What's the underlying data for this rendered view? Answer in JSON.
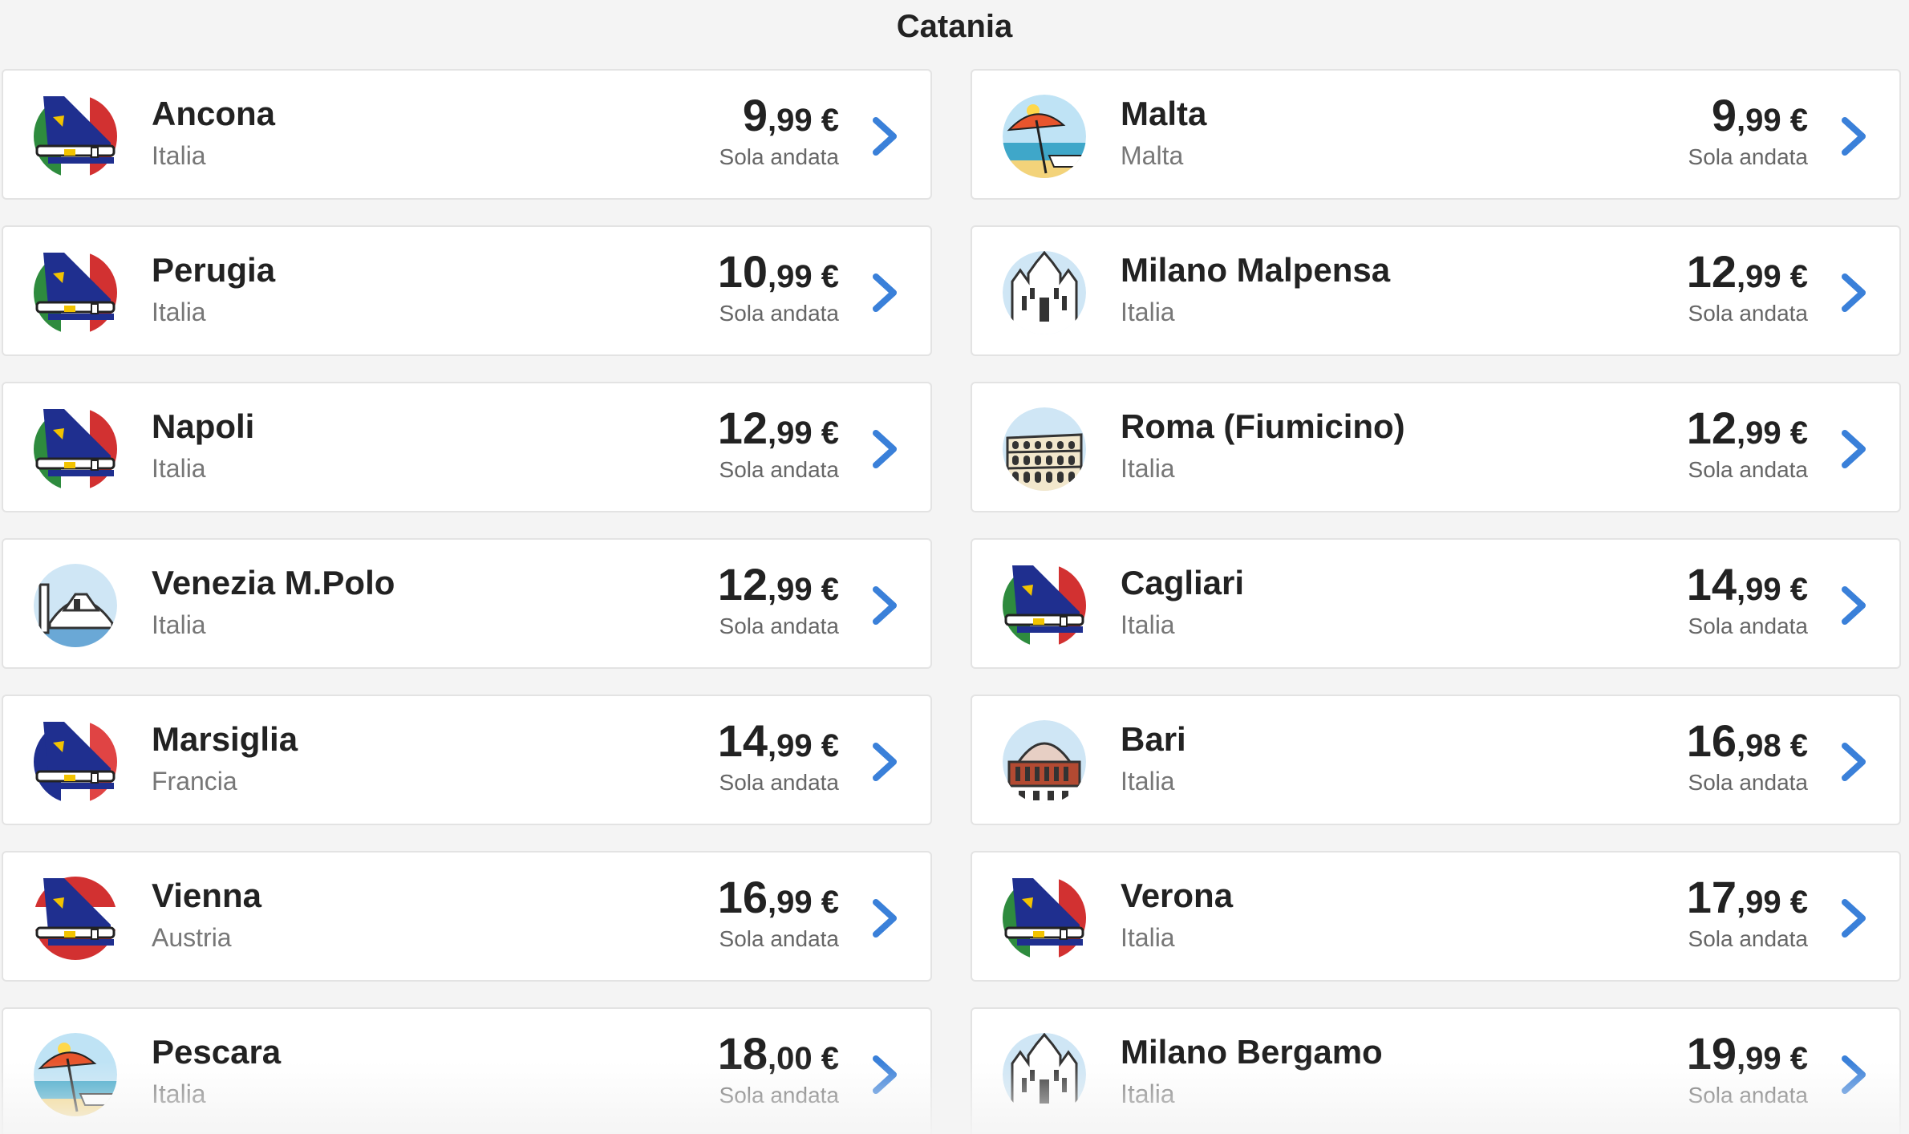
{
  "header": {
    "title": "Catania"
  },
  "fare_label": "Sola andata",
  "currency": "€",
  "colors": {
    "accent": "#3a80d9",
    "text": "#222222",
    "muted": "#777777"
  },
  "destinations": [
    {
      "city": "Ancona",
      "country": "Italia",
      "price_int": "9",
      "price_dec": ",99",
      "icon": "plane-tail-italy-icon"
    },
    {
      "city": "Malta",
      "country": "Malta",
      "price_int": "9",
      "price_dec": ",99",
      "icon": "beach-umbrella-icon"
    },
    {
      "city": "Perugia",
      "country": "Italia",
      "price_int": "10",
      "price_dec": ",99",
      "icon": "plane-tail-italy-icon"
    },
    {
      "city": "Milano Malpensa",
      "country": "Italia",
      "price_int": "12",
      "price_dec": ",99",
      "icon": "milan-cathedral-icon"
    },
    {
      "city": "Napoli",
      "country": "Italia",
      "price_int": "12",
      "price_dec": ",99",
      "icon": "plane-tail-italy-icon"
    },
    {
      "city": "Roma (Fiumicino)",
      "country": "Italia",
      "price_int": "12",
      "price_dec": ",99",
      "icon": "colosseum-icon"
    },
    {
      "city": "Venezia M.Polo",
      "country": "Italia",
      "price_int": "12",
      "price_dec": ",99",
      "icon": "rialto-bridge-icon"
    },
    {
      "city": "Cagliari",
      "country": "Italia",
      "price_int": "14",
      "price_dec": ",99",
      "icon": "plane-tail-italy-icon"
    },
    {
      "city": "Marsiglia",
      "country": "Francia",
      "price_int": "14",
      "price_dec": ",99",
      "icon": "plane-tail-france-icon"
    },
    {
      "city": "Bari",
      "country": "Italia",
      "price_int": "16",
      "price_dec": ",98",
      "icon": "dome-building-icon"
    },
    {
      "city": "Vienna",
      "country": "Austria",
      "price_int": "16",
      "price_dec": ",99",
      "icon": "plane-tail-austria-icon"
    },
    {
      "city": "Verona",
      "country": "Italia",
      "price_int": "17",
      "price_dec": ",99",
      "icon": "plane-tail-italy-icon"
    },
    {
      "city": "Pescara",
      "country": "Italia",
      "price_int": "18",
      "price_dec": ",00",
      "icon": "beach-umbrella-icon"
    },
    {
      "city": "Milano Bergamo",
      "country": "Italia",
      "price_int": "19",
      "price_dec": ",99",
      "icon": "milan-cathedral-icon"
    }
  ]
}
